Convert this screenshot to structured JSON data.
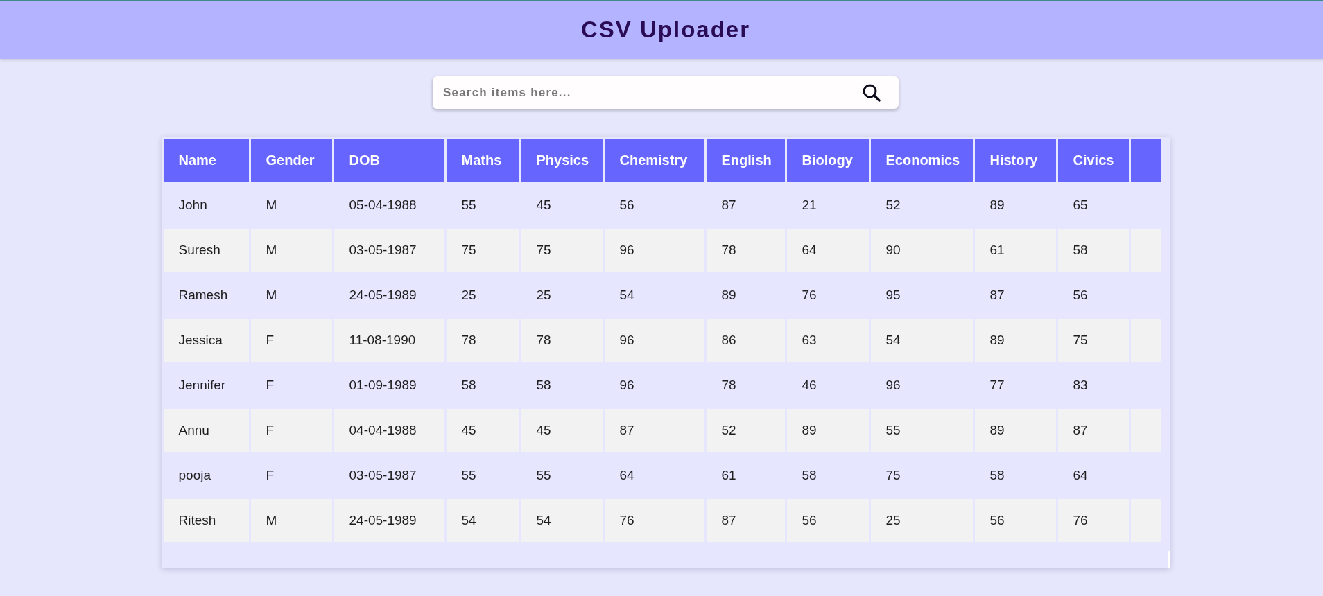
{
  "header": {
    "title": "CSV Uploader"
  },
  "search": {
    "placeholder": "Search items here..."
  },
  "table": {
    "columns": [
      "Name",
      "Gender",
      "DOB",
      "Maths",
      "Physics",
      "Chemistry",
      "English",
      "Biology",
      "Economics",
      "History",
      "Civics"
    ],
    "rows": [
      [
        "John",
        "M",
        "05-04-1988",
        "55",
        "45",
        "56",
        "87",
        "21",
        "52",
        "89",
        "65"
      ],
      [
        "Suresh",
        "M",
        "03-05-1987",
        "75",
        "75",
        "96",
        "78",
        "64",
        "90",
        "61",
        "58"
      ],
      [
        "Ramesh",
        "M",
        "24-05-1989",
        "25",
        "25",
        "54",
        "89",
        "76",
        "95",
        "87",
        "56"
      ],
      [
        "Jessica",
        "F",
        "11-08-1990",
        "78",
        "78",
        "96",
        "86",
        "63",
        "54",
        "89",
        "75"
      ],
      [
        "Jennifer",
        "F",
        "01-09-1989",
        "58",
        "58",
        "96",
        "78",
        "46",
        "96",
        "77",
        "83"
      ],
      [
        "Annu",
        "F",
        "04-04-1988",
        "45",
        "45",
        "87",
        "52",
        "89",
        "55",
        "89",
        "87"
      ],
      [
        "pooja",
        "F",
        "03-05-1987",
        "55",
        "55",
        "64",
        "61",
        "58",
        "75",
        "58",
        "64"
      ],
      [
        "Ritesh",
        "M",
        "24-05-1989",
        "54",
        "54",
        "76",
        "87",
        "56",
        "25",
        "56",
        "76"
      ]
    ]
  }
}
